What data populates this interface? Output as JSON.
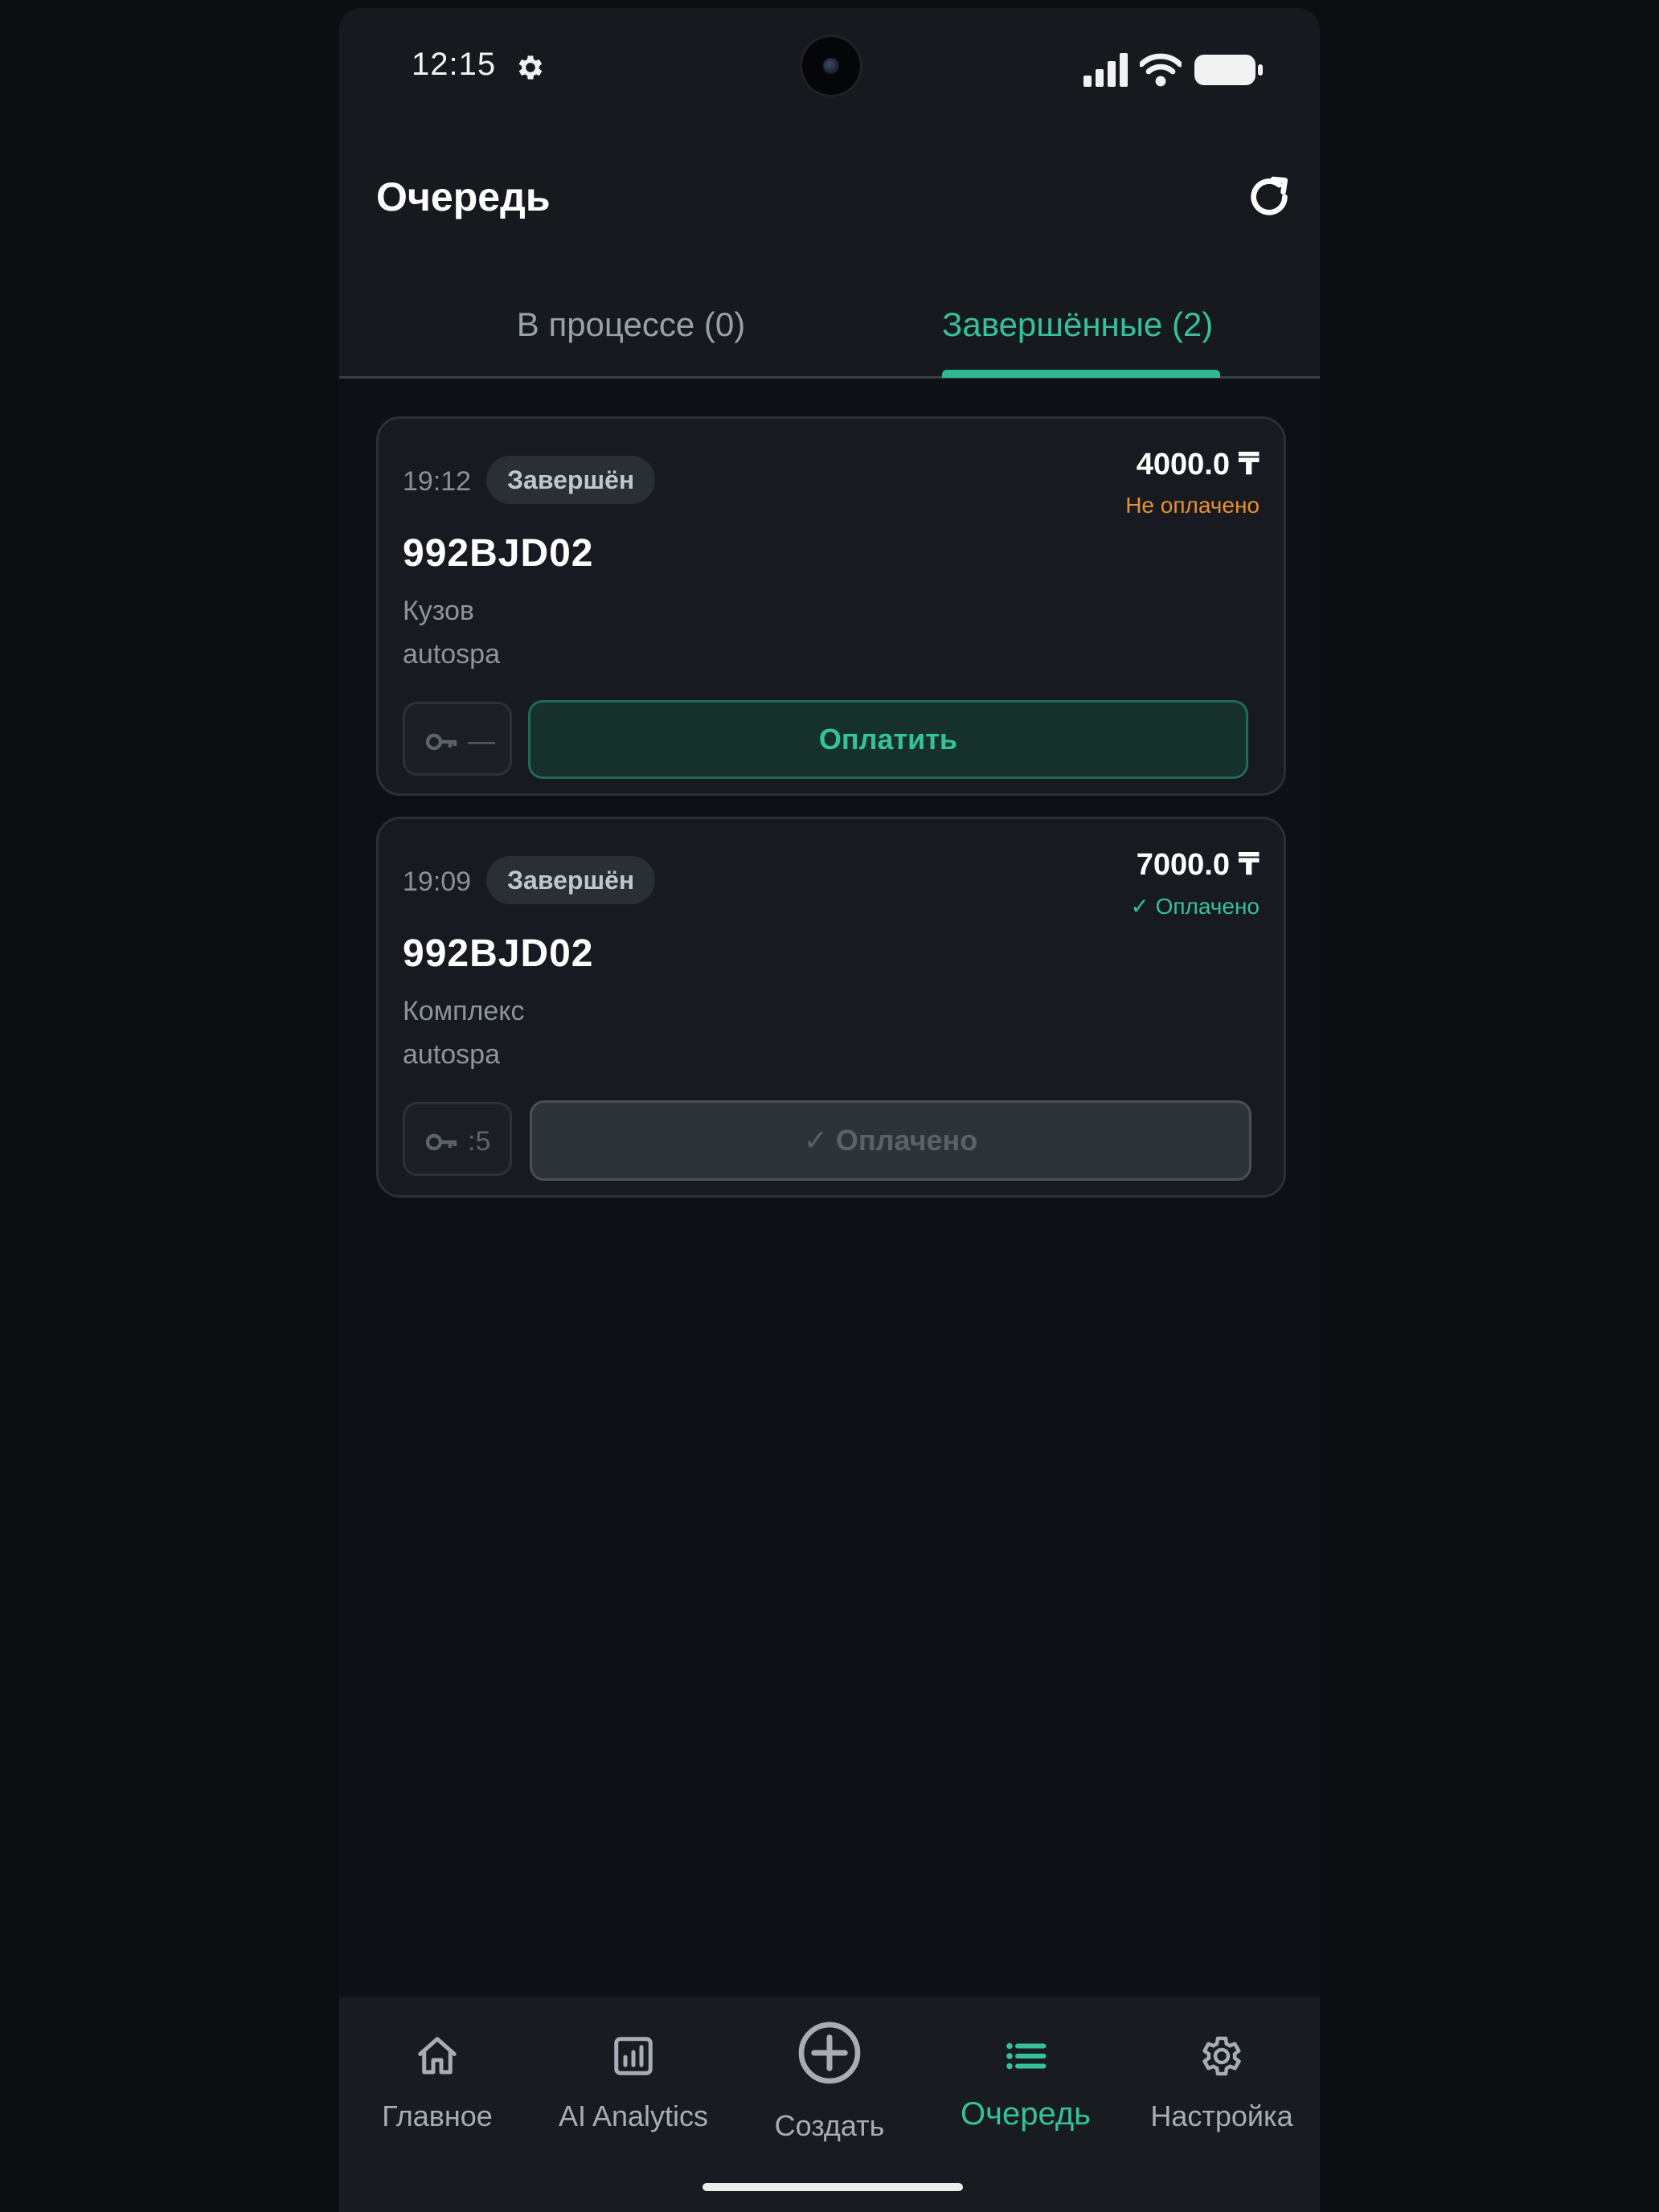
{
  "status_bar": {
    "time": "12:15"
  },
  "header": {
    "title": "Очередь"
  },
  "tabs": [
    {
      "label": "В процессе (0)",
      "active": false
    },
    {
      "label": "Завершённые (2)",
      "active": true
    }
  ],
  "orders": [
    {
      "time": "19:12",
      "status": "Завершён",
      "price": "4000.0 ₸",
      "payment_status": "Не оплачено",
      "plate": "992BJD02",
      "service": "Кузов",
      "company": "autospa",
      "key_value": "—",
      "action_label": "Оплатить"
    },
    {
      "time": "19:09",
      "status": "Завершён",
      "price": "7000.0 ₸",
      "payment_status": "✓ Оплачено",
      "plate": "992BJD02",
      "service": "Комплекс",
      "company": "autospa",
      "key_value": ":5",
      "action_label": "✓ Оплачено"
    }
  ],
  "bottom_nav": [
    {
      "label": "Главное",
      "icon": "home-icon"
    },
    {
      "label": "AI Analytics",
      "icon": "analytics-icon"
    },
    {
      "label": "Создать",
      "icon": "plus-circle-icon"
    },
    {
      "label": "Очередь",
      "icon": "list-icon",
      "active": true
    },
    {
      "label": "Настройка",
      "icon": "gear-icon"
    }
  ],
  "colors": {
    "accent": "#35c19a",
    "unpaid": "#e7902f",
    "background": "#0d1015",
    "card": "#171b21"
  }
}
